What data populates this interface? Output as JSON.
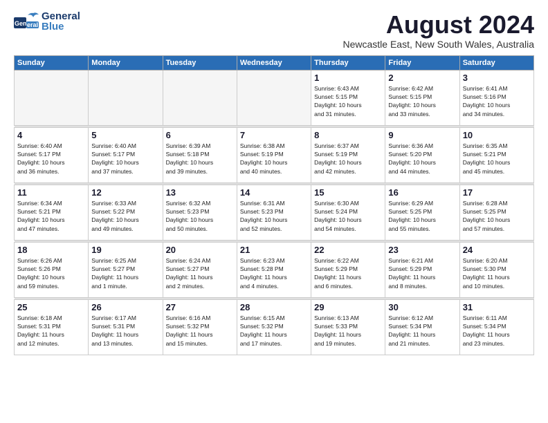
{
  "header": {
    "logo_general": "General",
    "logo_blue": "Blue",
    "month_year": "August 2024",
    "location": "Newcastle East, New South Wales, Australia"
  },
  "weekdays": [
    "Sunday",
    "Monday",
    "Tuesday",
    "Wednesday",
    "Thursday",
    "Friday",
    "Saturday"
  ],
  "weeks": [
    [
      {
        "day": "",
        "info": ""
      },
      {
        "day": "",
        "info": ""
      },
      {
        "day": "",
        "info": ""
      },
      {
        "day": "",
        "info": ""
      },
      {
        "day": "1",
        "info": "Sunrise: 6:43 AM\nSunset: 5:15 PM\nDaylight: 10 hours\nand 31 minutes."
      },
      {
        "day": "2",
        "info": "Sunrise: 6:42 AM\nSunset: 5:15 PM\nDaylight: 10 hours\nand 33 minutes."
      },
      {
        "day": "3",
        "info": "Sunrise: 6:41 AM\nSunset: 5:16 PM\nDaylight: 10 hours\nand 34 minutes."
      }
    ],
    [
      {
        "day": "4",
        "info": "Sunrise: 6:40 AM\nSunset: 5:17 PM\nDaylight: 10 hours\nand 36 minutes."
      },
      {
        "day": "5",
        "info": "Sunrise: 6:40 AM\nSunset: 5:17 PM\nDaylight: 10 hours\nand 37 minutes."
      },
      {
        "day": "6",
        "info": "Sunrise: 6:39 AM\nSunset: 5:18 PM\nDaylight: 10 hours\nand 39 minutes."
      },
      {
        "day": "7",
        "info": "Sunrise: 6:38 AM\nSunset: 5:19 PM\nDaylight: 10 hours\nand 40 minutes."
      },
      {
        "day": "8",
        "info": "Sunrise: 6:37 AM\nSunset: 5:19 PM\nDaylight: 10 hours\nand 42 minutes."
      },
      {
        "day": "9",
        "info": "Sunrise: 6:36 AM\nSunset: 5:20 PM\nDaylight: 10 hours\nand 44 minutes."
      },
      {
        "day": "10",
        "info": "Sunrise: 6:35 AM\nSunset: 5:21 PM\nDaylight: 10 hours\nand 45 minutes."
      }
    ],
    [
      {
        "day": "11",
        "info": "Sunrise: 6:34 AM\nSunset: 5:21 PM\nDaylight: 10 hours\nand 47 minutes."
      },
      {
        "day": "12",
        "info": "Sunrise: 6:33 AM\nSunset: 5:22 PM\nDaylight: 10 hours\nand 49 minutes."
      },
      {
        "day": "13",
        "info": "Sunrise: 6:32 AM\nSunset: 5:23 PM\nDaylight: 10 hours\nand 50 minutes."
      },
      {
        "day": "14",
        "info": "Sunrise: 6:31 AM\nSunset: 5:23 PM\nDaylight: 10 hours\nand 52 minutes."
      },
      {
        "day": "15",
        "info": "Sunrise: 6:30 AM\nSunset: 5:24 PM\nDaylight: 10 hours\nand 54 minutes."
      },
      {
        "day": "16",
        "info": "Sunrise: 6:29 AM\nSunset: 5:25 PM\nDaylight: 10 hours\nand 55 minutes."
      },
      {
        "day": "17",
        "info": "Sunrise: 6:28 AM\nSunset: 5:25 PM\nDaylight: 10 hours\nand 57 minutes."
      }
    ],
    [
      {
        "day": "18",
        "info": "Sunrise: 6:26 AM\nSunset: 5:26 PM\nDaylight: 10 hours\nand 59 minutes."
      },
      {
        "day": "19",
        "info": "Sunrise: 6:25 AM\nSunset: 5:27 PM\nDaylight: 11 hours\nand 1 minute."
      },
      {
        "day": "20",
        "info": "Sunrise: 6:24 AM\nSunset: 5:27 PM\nDaylight: 11 hours\nand 2 minutes."
      },
      {
        "day": "21",
        "info": "Sunrise: 6:23 AM\nSunset: 5:28 PM\nDaylight: 11 hours\nand 4 minutes."
      },
      {
        "day": "22",
        "info": "Sunrise: 6:22 AM\nSunset: 5:29 PM\nDaylight: 11 hours\nand 6 minutes."
      },
      {
        "day": "23",
        "info": "Sunrise: 6:21 AM\nSunset: 5:29 PM\nDaylight: 11 hours\nand 8 minutes."
      },
      {
        "day": "24",
        "info": "Sunrise: 6:20 AM\nSunset: 5:30 PM\nDaylight: 11 hours\nand 10 minutes."
      }
    ],
    [
      {
        "day": "25",
        "info": "Sunrise: 6:18 AM\nSunset: 5:31 PM\nDaylight: 11 hours\nand 12 minutes."
      },
      {
        "day": "26",
        "info": "Sunrise: 6:17 AM\nSunset: 5:31 PM\nDaylight: 11 hours\nand 13 minutes."
      },
      {
        "day": "27",
        "info": "Sunrise: 6:16 AM\nSunset: 5:32 PM\nDaylight: 11 hours\nand 15 minutes."
      },
      {
        "day": "28",
        "info": "Sunrise: 6:15 AM\nSunset: 5:32 PM\nDaylight: 11 hours\nand 17 minutes."
      },
      {
        "day": "29",
        "info": "Sunrise: 6:13 AM\nSunset: 5:33 PM\nDaylight: 11 hours\nand 19 minutes."
      },
      {
        "day": "30",
        "info": "Sunrise: 6:12 AM\nSunset: 5:34 PM\nDaylight: 11 hours\nand 21 minutes."
      },
      {
        "day": "31",
        "info": "Sunrise: 6:11 AM\nSunset: 5:34 PM\nDaylight: 11 hours\nand 23 minutes."
      }
    ]
  ]
}
